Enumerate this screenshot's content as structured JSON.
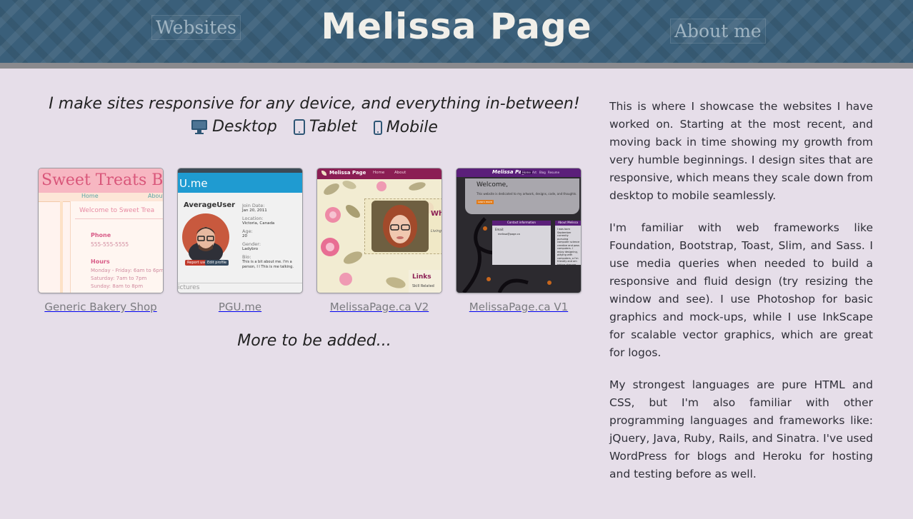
{
  "header": {
    "title": "Melissa Page",
    "nav": {
      "websites": "Websites",
      "about": "About me"
    }
  },
  "main": {
    "tagline": "I make sites responsive for any device, and everything in-between!",
    "devices": [
      {
        "label": "Desktop",
        "icon": "desktop-icon"
      },
      {
        "label": "Tablet",
        "icon": "tablet-icon"
      },
      {
        "label": "Mobile",
        "icon": "mobile-icon"
      }
    ],
    "projects": [
      {
        "label": "Generic Bakery Shop",
        "thumb": {
          "heading": "Sweet Treats B",
          "nav_home": "Home",
          "nav_about": "About",
          "welcome": "Welcome to Sweet Trea",
          "phone_label": "Phone",
          "phone": "555-555-5555",
          "hours_label": "Hours",
          "hours": [
            "Monday - Friday: 6am to 6pm",
            "Saturday: 7am to 7pm",
            "Sunday: 8am to 8pm"
          ]
        }
      },
      {
        "label": "PGU.me",
        "thumb": {
          "brand": "U.me",
          "user": "AverageUser",
          "fields": [
            {
              "k": "Join Date:",
              "v": "Jan 20, 2011"
            },
            {
              "k": "Location:",
              "v": "Victoria, Canada"
            },
            {
              "k": "Age:",
              "v": "20"
            },
            {
              "k": "Gender:",
              "v": "Ladybro"
            },
            {
              "k": "Bio:",
              "v": "This is a bit about me. I'm a person, I l This is me talking. Talking like I l"
            }
          ],
          "btn_report": "Report user",
          "btn_edit": "Edit profile",
          "footer": "ictures"
        }
      },
      {
        "label": "MelissaPage.ca V2",
        "thumb": {
          "brand": "Melissa Page",
          "nav": [
            "Home",
            "About"
          ],
          "side_title": "Wh",
          "side_sub": "Living",
          "links": "Links",
          "skill": "Skill Related"
        }
      },
      {
        "label": "MelissaPage.ca V1",
        "thumb": {
          "brand": "Melissa Page",
          "nav": [
            "Home",
            "Art",
            "Blog",
            "Resume"
          ],
          "welcome": "Welcome,",
          "intro": "This website is dedicated to my artwork, designs, code, and thoughts.",
          "button": "Learn more",
          "panel1": "Contact information",
          "panel2": "About Melissa",
          "email_label": "Email:",
          "email": "melissa@page.ca",
          "bio": "I was born September currently pursuing computer science creative and pass computers. I enjoy designing, playing with computers, a I'm friendly and am taking chances"
        }
      }
    ],
    "more": "More to be added..."
  },
  "about": {
    "paragraphs": [
      "This is where I showcase the websites I have worked on. Starting at the most recent, and moving back in time showing my growth from very humble beginnings. I design sites that are responsive, which means they scale down from desktop to mobile seamlessly.",
      "I'm familiar with web frameworks like Foundation, Bootstrap, Toast, Slim, and Sass. I use media queries when needed to build a responsive and fluid design (try resizing the window and see). I use Photoshop for basic graphics and mock-ups, while I use InkScape for scalable vector graphics, which are great for logos.",
      "My strongest languages are pure HTML and CSS, but I'm also familiar with other programming languages and frameworks like: jQuery, Java, Ruby, Rails, and Sinatra. I've used WordPress for blogs and Heroku for hosting and testing before as well."
    ]
  },
  "colors": {
    "header_bg": "#3a5f7a",
    "page_bg": "#e6dee9",
    "title": "#f1efe9",
    "nav_text": "#9fb4c2",
    "caption": "#7b7b80"
  }
}
